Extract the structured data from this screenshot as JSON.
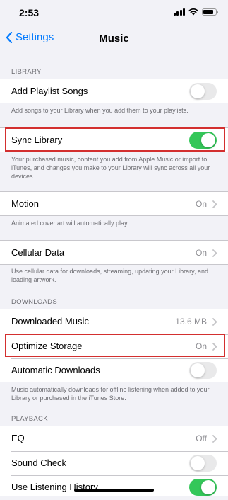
{
  "status": {
    "time": "2:53"
  },
  "nav": {
    "back_label": "Settings",
    "title": "Music"
  },
  "sections": {
    "library": "LIBRARY",
    "downloads": "DOWNLOADS",
    "playback": "PLAYBACK"
  },
  "rows": {
    "add_playlist_songs": {
      "label": "Add Playlist Songs",
      "toggle": "off"
    },
    "sync_library": {
      "label": "Sync Library",
      "toggle": "on"
    },
    "motion": {
      "label": "Motion",
      "value": "On"
    },
    "cellular_data": {
      "label": "Cellular Data",
      "value": "On"
    },
    "downloaded_music": {
      "label": "Downloaded Music",
      "value": "13.6 MB"
    },
    "optimize_storage": {
      "label": "Optimize Storage",
      "value": "On"
    },
    "automatic_downloads": {
      "label": "Automatic Downloads",
      "toggle": "off"
    },
    "eq": {
      "label": "EQ",
      "value": "Off"
    },
    "sound_check": {
      "label": "Sound Check",
      "toggle": "off"
    },
    "use_listening_history": {
      "label": "Use Listening History",
      "toggle": "on"
    }
  },
  "footers": {
    "add_playlist_songs": "Add songs to your Library when you add them to your playlists.",
    "sync_library": "Your purchased music, content you add from Apple Music or import to iTunes, and changes you make to your Library will sync across all your devices.",
    "motion": "Animated cover art will automatically play.",
    "cellular_data": "Use cellular data for downloads, streaming, updating your Library, and loading artwork.",
    "automatic_downloads": "Music automatically downloads for offline listening when added to your Library or purchased in the iTunes Store."
  },
  "colors": {
    "accent": "#007aff",
    "toggle_on": "#34c759",
    "highlight": "#d32f2f",
    "background": "#f2f2f7"
  }
}
